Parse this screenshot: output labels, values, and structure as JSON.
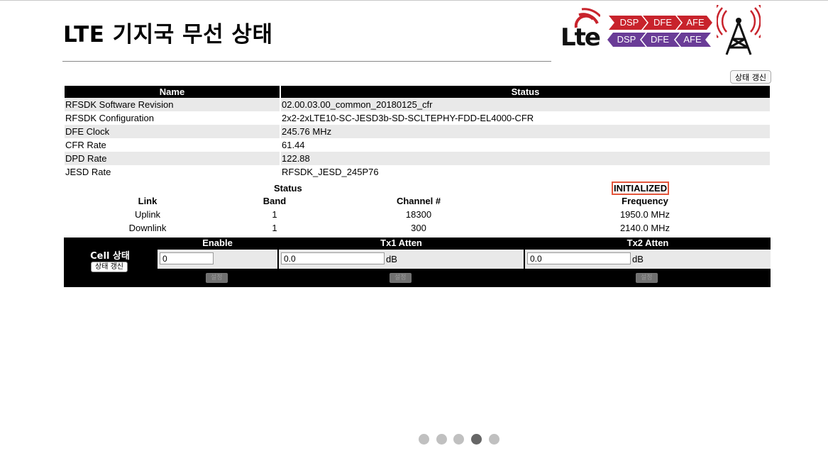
{
  "page": {
    "title": "LTE 기지국 무선 상태"
  },
  "logo": {
    "lte_text": "Lte",
    "chevrons_top": [
      "DSP",
      "DFE",
      "AFE"
    ],
    "chevrons_bottom": [
      "DSP",
      "DFE",
      "AFE"
    ],
    "colors": {
      "red": "#c8232c",
      "purple": "#6a3c97"
    },
    "icons": [
      "lte-signal-arcs-icon",
      "radio-tower-icon"
    ]
  },
  "refresh_button": "상태 갱신",
  "info_table": {
    "headers": {
      "name": "Name",
      "status": "Status"
    },
    "rows": [
      {
        "name": "RFSDK Software Revision",
        "value": "02.00.03.00_common_20180125_cfr"
      },
      {
        "name": "RFSDK Configuration",
        "value": "2x2-2xLTE10-SC-JESD3b-SD-SCLTEPHY-FDD-EL4000-CFR"
      },
      {
        "name": "DFE Clock",
        "value": "245.76 MHz"
      },
      {
        "name": "CFR Rate",
        "value": "61.44"
      },
      {
        "name": "DPD Rate",
        "value": "122.88"
      },
      {
        "name": "JESD Rate",
        "value": "RFSDK_JESD_245P76"
      }
    ]
  },
  "link_status": {
    "label": "Status",
    "value": "INITIALIZED",
    "highlight_color": "#e3563c",
    "headers": {
      "link": "Link",
      "band": "Band",
      "channel": "Channel #",
      "frequency": "Frequency"
    },
    "rows": [
      {
        "link": "Uplink",
        "band": "1",
        "channel": "18300",
        "frequency": "1950.0 MHz"
      },
      {
        "link": "Downlink",
        "band": "1",
        "channel": "300",
        "frequency": "2140.0 MHz"
      }
    ]
  },
  "cell_control": {
    "label": "Cell 상태",
    "refresh_button": "상태 갱신",
    "enable": {
      "header": "Enable",
      "value": "0",
      "button": "설정"
    },
    "tx1": {
      "header": "Tx1 Atten",
      "value": "0.0",
      "unit": "dB",
      "button": "설정"
    },
    "tx2": {
      "header": "Tx2 Atten",
      "value": "0.0",
      "unit": "dB",
      "button": "설정"
    }
  },
  "pager": {
    "count": 5,
    "active_index": 3
  }
}
